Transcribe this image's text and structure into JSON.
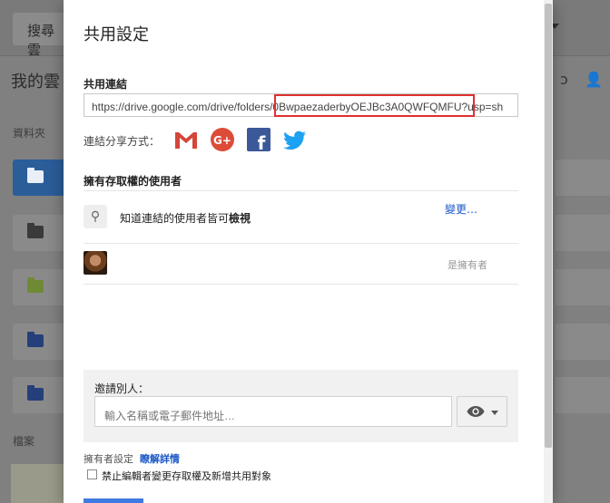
{
  "background": {
    "search_label": "搜尋雲",
    "title": "我的雲",
    "folders_label": "資料夾",
    "files_label": "檔案"
  },
  "dialog": {
    "title": "共用設定",
    "share_link_label": "共用連結",
    "share_link_value": "https://drive.google.com/drive/folders/0BwpaezaderbyOEJBc3A0QWFQMFU?usp=sh",
    "share_via_label": "連結分享方式：",
    "share_icons": [
      "gmail-icon",
      "google-plus-icon",
      "facebook-icon",
      "twitter-icon"
    ],
    "access_label": "擁有存取權的使用者",
    "access_row": {
      "text_prefix": "知道連結的使用者皆可",
      "text_bold": "檢視",
      "change_link": "變更…"
    },
    "owner_row": {
      "role": "是擁有者"
    },
    "invite": {
      "label": "邀請別人：",
      "placeholder": "輸入名稱或電子郵件地址…",
      "permission_icon": "eye-icon"
    },
    "owner_settings_label": "擁有者設定",
    "learn_more_link": "瞭解詳情",
    "restrict_checkbox_label": "禁止編輯者變更存取權及新增共用對象",
    "restrict_checked": false
  },
  "colors": {
    "link_blue": "#1a58c8",
    "highlight_red": "#e03030",
    "gmail_red": "#d44638",
    "gplus_red": "#dd4b39",
    "facebook_blue": "#3b5998",
    "twitter_blue": "#1da1f2"
  }
}
